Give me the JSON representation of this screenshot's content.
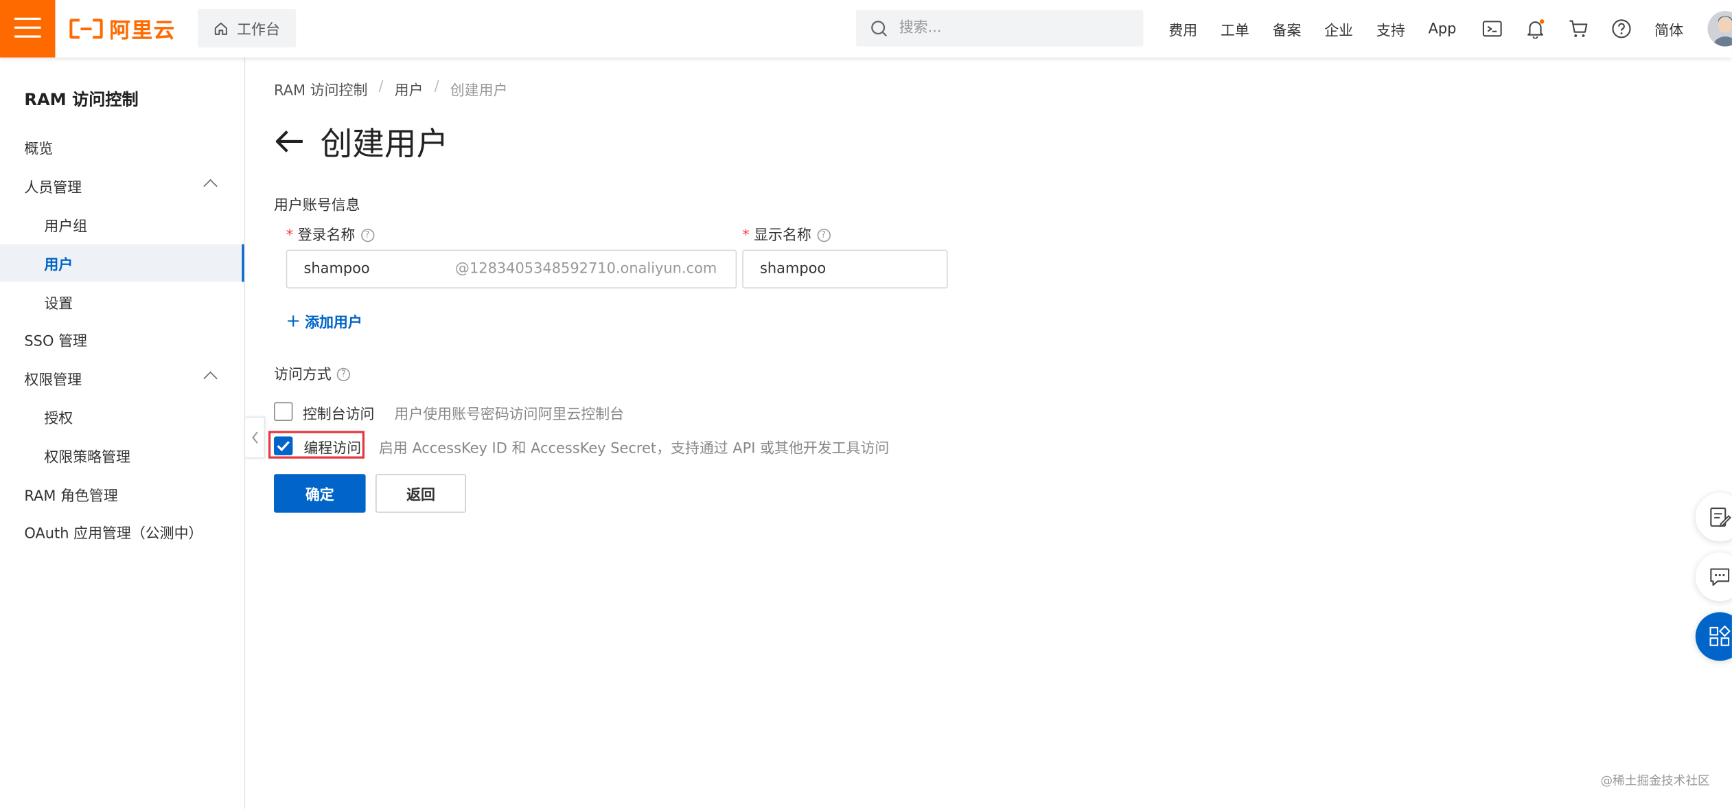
{
  "topbar": {
    "logo_text": "阿里云",
    "workbench_label": "工作台",
    "search_placeholder": "搜索...",
    "nav_links": [
      "费用",
      "工单",
      "备案",
      "企业",
      "支持",
      "App"
    ],
    "lang_label": "简体",
    "accent_color": "#ff6a00"
  },
  "sidebar": {
    "title": "RAM 访问控制",
    "items": [
      {
        "label": "概览"
      },
      {
        "label": "人员管理",
        "expanded": true
      },
      {
        "label": "用户组"
      },
      {
        "label": "用户",
        "active": true
      },
      {
        "label": "设置"
      },
      {
        "label": "SSO 管理"
      },
      {
        "label": "权限管理",
        "expanded": true
      },
      {
        "label": "授权"
      },
      {
        "label": "权限策略管理"
      },
      {
        "label": "RAM 角色管理"
      },
      {
        "label": "OAuth 应用管理（公测中）"
      }
    ]
  },
  "breadcrumb": {
    "items": [
      "RAM 访问控制",
      "用户",
      "创建用户"
    ],
    "separator": "/"
  },
  "page": {
    "title": "创建用户"
  },
  "form": {
    "section_account": "用户账号信息",
    "login_name_label": "登录名称",
    "login_name_value": "shampoo",
    "login_name_suffix": "@1283405348592710.onaliyun.com",
    "display_name_label": "显示名称",
    "display_name_value": "shampoo",
    "required_mark": "*",
    "help_mark": "?",
    "add_user_label": "添加用户",
    "section_access": "访问方式",
    "console_access_label": "控制台访问",
    "console_access_desc": "用户使用账号密码访问阿里云控制台",
    "console_access_checked": false,
    "programmatic_access_label": "编程访问",
    "programmatic_access_desc": "启用 AccessKey ID 和 AccessKey Secret，支持通过 API 或其他开发工具访问",
    "programmatic_access_checked": true,
    "confirm_label": "确定",
    "back_label": "返回",
    "primary_color": "#0064c8",
    "highlight_color": "#e6363f"
  },
  "watermark": "@稀土掘金技术社区"
}
